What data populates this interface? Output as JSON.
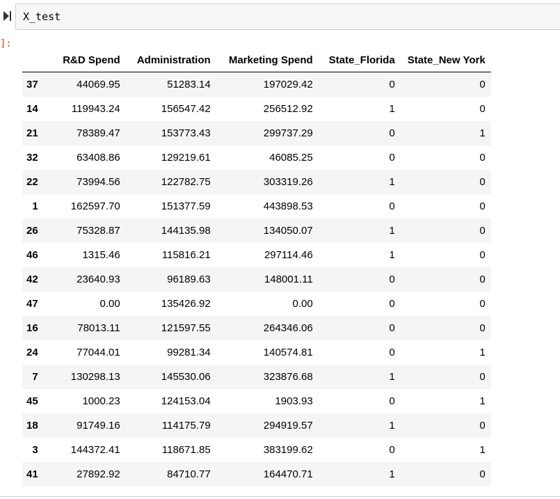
{
  "input_cell": {
    "code": "X_test",
    "run_icon": "run-cell-icon"
  },
  "output_cell": {
    "prompt": "]:"
  },
  "dataframe": {
    "columns": [
      "R&D Spend",
      "Administration",
      "Marketing Spend",
      "State_Florida",
      "State_New York"
    ],
    "rows": [
      {
        "index": "37",
        "values": [
          "44069.95",
          "51283.14",
          "197029.42",
          "0",
          "0"
        ]
      },
      {
        "index": "14",
        "values": [
          "119943.24",
          "156547.42",
          "256512.92",
          "1",
          "0"
        ]
      },
      {
        "index": "21",
        "values": [
          "78389.47",
          "153773.43",
          "299737.29",
          "0",
          "1"
        ]
      },
      {
        "index": "32",
        "values": [
          "63408.86",
          "129219.61",
          "46085.25",
          "0",
          "0"
        ]
      },
      {
        "index": "22",
        "values": [
          "73994.56",
          "122782.75",
          "303319.26",
          "1",
          "0"
        ]
      },
      {
        "index": "1",
        "values": [
          "162597.70",
          "151377.59",
          "443898.53",
          "0",
          "0"
        ]
      },
      {
        "index": "26",
        "values": [
          "75328.87",
          "144135.98",
          "134050.07",
          "1",
          "0"
        ]
      },
      {
        "index": "46",
        "values": [
          "1315.46",
          "115816.21",
          "297114.46",
          "1",
          "0"
        ]
      },
      {
        "index": "42",
        "values": [
          "23640.93",
          "96189.63",
          "148001.11",
          "0",
          "0"
        ]
      },
      {
        "index": "47",
        "values": [
          "0.00",
          "135426.92",
          "0.00",
          "0",
          "0"
        ]
      },
      {
        "index": "16",
        "values": [
          "78013.11",
          "121597.55",
          "264346.06",
          "0",
          "0"
        ]
      },
      {
        "index": "24",
        "values": [
          "77044.01",
          "99281.34",
          "140574.81",
          "0",
          "1"
        ]
      },
      {
        "index": "7",
        "values": [
          "130298.13",
          "145530.06",
          "323876.68",
          "1",
          "0"
        ]
      },
      {
        "index": "45",
        "values": [
          "1000.23",
          "124153.04",
          "1903.93",
          "0",
          "1"
        ]
      },
      {
        "index": "18",
        "values": [
          "91749.16",
          "114175.79",
          "294919.57",
          "1",
          "0"
        ]
      },
      {
        "index": "3",
        "values": [
          "144372.41",
          "118671.85",
          "383199.62",
          "0",
          "1"
        ]
      },
      {
        "index": "41",
        "values": [
          "27892.92",
          "84710.77",
          "164470.71",
          "1",
          "0"
        ]
      }
    ]
  }
}
